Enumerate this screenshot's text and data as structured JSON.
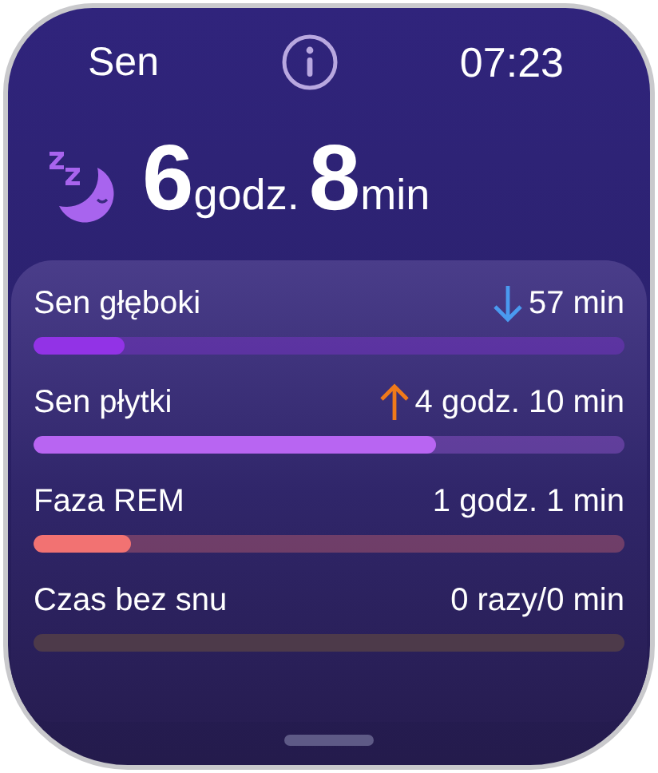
{
  "header": {
    "title": "Sen",
    "time": "07:23"
  },
  "summary": {
    "hours": "6",
    "hours_unit": "godz.",
    "minutes": "8",
    "minutes_unit": "min"
  },
  "stages": [
    {
      "label": "Sen głęboki",
      "value": "57 min",
      "kind": "decrease",
      "level": 0.155,
      "color": "#9233e6"
    },
    {
      "label": "Sen płytki",
      "value": "4 godz. 10 min",
      "kind": "increase",
      "level": 0.68,
      "color": "#b865f2"
    },
    {
      "label": "Faza REM",
      "kind": "plain",
      "value": "1 godz. 1 min",
      "level": 0.165,
      "color": "#f27272"
    },
    {
      "label": "Czas bez snu",
      "kind": "plain",
      "value": "0 razy/0 min",
      "color": "#4d3a4a"
    }
  ]
}
